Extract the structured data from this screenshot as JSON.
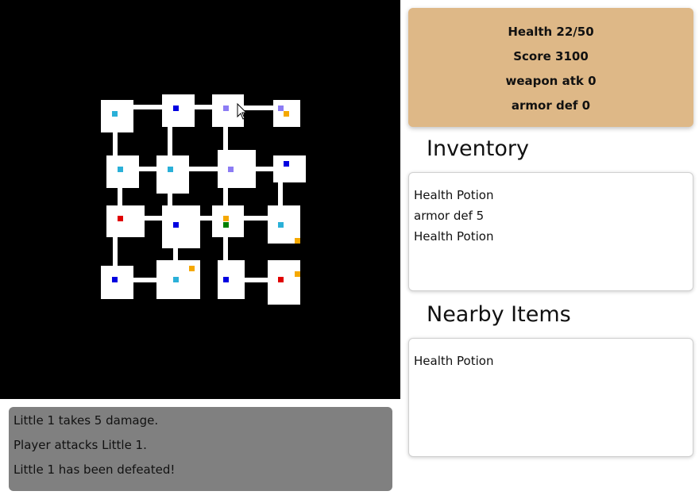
{
  "stats": {
    "health": "Health 22/50",
    "score": "Score 3100",
    "weapon": "weapon atk 0",
    "armor": "armor def 0"
  },
  "inventory": {
    "title": "Inventory",
    "items": [
      "Health Potion",
      "armor def 5",
      "Health Potion"
    ]
  },
  "nearby": {
    "title": "Nearby Items",
    "items": [
      "Health Potion"
    ]
  },
  "log": [
    "Little 1 takes 5 damage.",
    "Player attacks Little 1.",
    "Little 1 has been defeated!"
  ],
  "colors": {
    "map_bg": "#000000",
    "room": "#ffffff",
    "stats_bg": "#deb887",
    "log_bg": "#808080",
    "item_light_blue": "#2ab0d8",
    "item_blue": "#0000e0",
    "item_purple": "#8c7cf4",
    "item_orange": "#f5a800",
    "item_red": "#e00000",
    "player_green": "#008000"
  },
  "map": {
    "grid_columns": 4,
    "grid_rows": 4,
    "markers": [
      {
        "room": [
          0,
          0
        ],
        "type": "light-blue"
      },
      {
        "room": [
          1,
          0
        ],
        "type": "blue"
      },
      {
        "room": [
          2,
          0
        ],
        "type": "purple"
      },
      {
        "room": [
          3,
          0
        ],
        "type": "purple"
      },
      {
        "room": [
          3,
          0
        ],
        "type": "orange"
      },
      {
        "room": [
          0,
          1
        ],
        "type": "light-blue"
      },
      {
        "room": [
          1,
          1
        ],
        "type": "light-blue"
      },
      {
        "room": [
          2,
          1
        ],
        "type": "purple"
      },
      {
        "room": [
          3,
          1
        ],
        "type": "blue"
      },
      {
        "room": [
          0,
          2
        ],
        "type": "red"
      },
      {
        "room": [
          1,
          2
        ],
        "type": "blue"
      },
      {
        "room": [
          2,
          2
        ],
        "type": "orange"
      },
      {
        "room": [
          2,
          2
        ],
        "type": "player-green"
      },
      {
        "room": [
          3,
          2
        ],
        "type": "light-blue"
      },
      {
        "room": [
          3,
          2
        ],
        "type": "orange"
      },
      {
        "room": [
          0,
          3
        ],
        "type": "blue"
      },
      {
        "room": [
          1,
          3
        ],
        "type": "light-blue"
      },
      {
        "room": [
          1,
          3
        ],
        "type": "orange"
      },
      {
        "room": [
          2,
          3
        ],
        "type": "blue"
      },
      {
        "room": [
          3,
          3
        ],
        "type": "red"
      },
      {
        "room": [
          3,
          3
        ],
        "type": "orange"
      }
    ]
  }
}
